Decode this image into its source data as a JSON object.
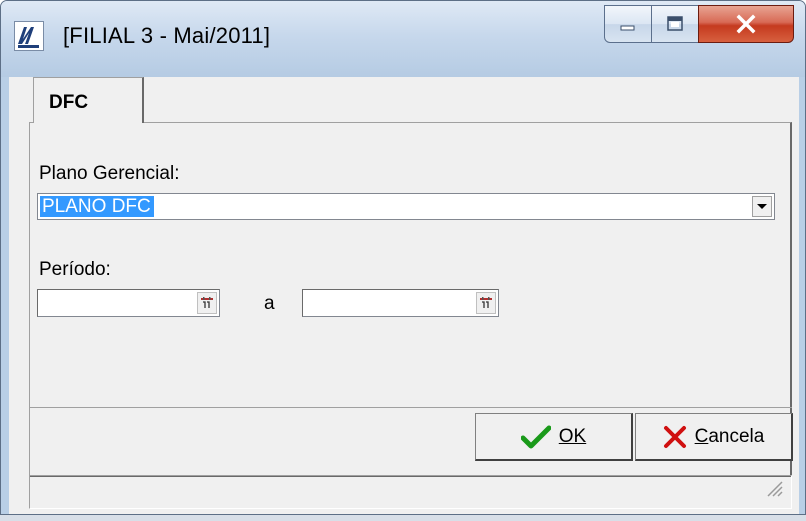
{
  "window": {
    "title": "[FILIAL 3 - Mai/2011]",
    "icon": "app-logo-icon",
    "controls": [
      "minimize-icon",
      "maximize-icon",
      "close-icon"
    ]
  },
  "tabs": [
    {
      "label": "DFC",
      "active": true
    }
  ],
  "form": {
    "plano_label": "Plano Gerencial:",
    "plano_value": "PLANO DFC",
    "periodo_label": "Período:",
    "periodo_separator": "a",
    "periodo_start": "",
    "periodo_end": ""
  },
  "buttons": {
    "ok_label": "OK",
    "ok_icon": "checkmark-icon",
    "cancel_label": "Cancela",
    "cancel_icon": "x-icon"
  },
  "colors": {
    "selection": "#3399ff",
    "ok_icon": "#1a9a1a",
    "cancel_icon": "#d01010"
  }
}
